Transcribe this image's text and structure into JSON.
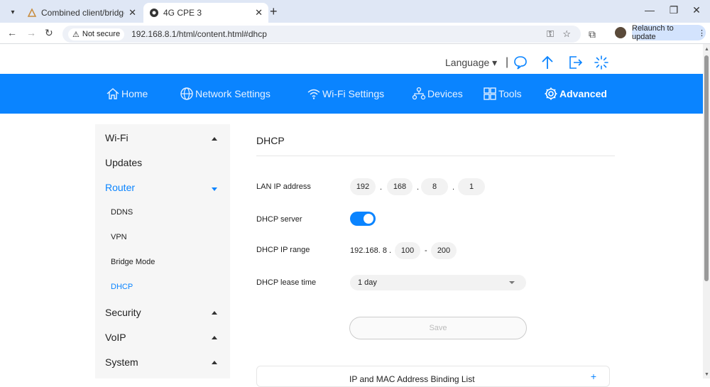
{
  "browser": {
    "tabs": [
      {
        "title": "Combined client/bridge or brid",
        "active": false
      },
      {
        "title": "4G CPE 3",
        "active": true
      }
    ],
    "security_label": "Not secure",
    "url": "192.168.8.1/html/content.html#dhcp",
    "relaunch_label": "Relaunch to update"
  },
  "topbar": {
    "language_label": "Language"
  },
  "nav": {
    "items": [
      {
        "label": "Home",
        "icon": "home-icon"
      },
      {
        "label": "Network Settings",
        "icon": "globe-icon"
      },
      {
        "label": "Wi-Fi Settings",
        "icon": "wifi-icon"
      },
      {
        "label": "Devices",
        "icon": "devices-icon"
      },
      {
        "label": "Tools",
        "icon": "tools-icon"
      },
      {
        "label": "Advanced",
        "icon": "gear-icon",
        "active": true
      }
    ],
    "bar_color": "#0a84ff"
  },
  "sidebar": {
    "items": [
      {
        "label": "Wi-Fi"
      },
      {
        "label": "Updates"
      },
      {
        "label": "Router"
      },
      {
        "label": "DDNS"
      },
      {
        "label": "VPN"
      },
      {
        "label": "Bridge Mode"
      },
      {
        "label": "DHCP"
      },
      {
        "label": "Security"
      },
      {
        "label": "VoIP"
      },
      {
        "label": "System"
      }
    ]
  },
  "dhcp": {
    "title": "DHCP",
    "lan_ip_label": "LAN IP address",
    "lan_ip": [
      "192",
      "168",
      "8",
      "1"
    ],
    "server_label": "DHCP server",
    "server_enabled": true,
    "range_label": "DHCP IP range",
    "range_prefix": "192.168. 8 .",
    "range_start": "100",
    "range_dash": "-",
    "range_end": "200",
    "lease_label": "DHCP lease time",
    "lease_value": "1 day",
    "save_label": "Save",
    "card_title": "IP and MAC Address Binding List",
    "card_plus": "+"
  }
}
